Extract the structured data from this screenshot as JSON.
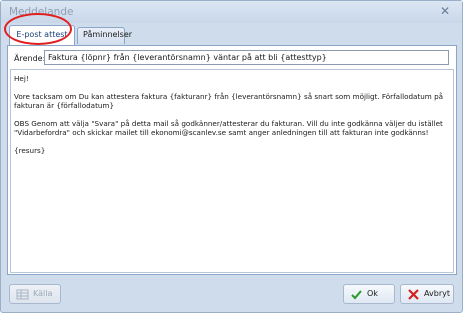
{
  "window": {
    "title": "Meddelande",
    "close_glyph": "✕"
  },
  "tabs": [
    {
      "label": "E-post attest",
      "active": true
    },
    {
      "label": "Påminnelser",
      "active": false
    }
  ],
  "subject": {
    "label": "Ärende:",
    "value": "Faktura {löpnr} från {leverantörsnamn} väntar på att bli  {attesttyp}"
  },
  "body": {
    "line1": "Hej!",
    "line2": "Vore tacksam om Du kan attestera faktura {fakturanr} från {leverantörsnamn} så snart som möjligt. Förfallodatum på fakturan är {förfallodatum}",
    "line3": "OBS Genom att välja \"Svara\" på detta mail så godkänner/attesterar du fakturan. Vill du inte godkänna väljer du istället \"Vidarbefordra\" och skickar mailet till ekonomi@scanlev.se samt anger anledningen till att fakturan inte godkänns!",
    "line4": "{resurs}"
  },
  "buttons": {
    "source": "Källa",
    "ok": "Ok",
    "cancel": "Avbryt"
  },
  "colors": {
    "highlight_ring": "#e02020",
    "ok_check": "#2a9a2a",
    "cancel_x": "#d42020"
  }
}
